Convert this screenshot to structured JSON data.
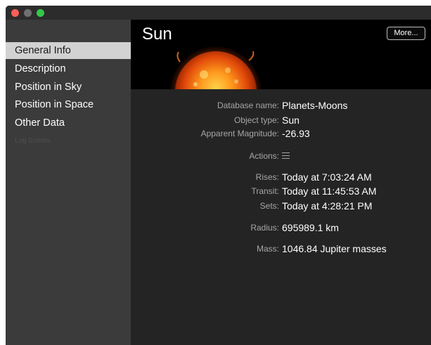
{
  "sidebar": {
    "items": [
      {
        "label": "General Info"
      },
      {
        "label": "Description"
      },
      {
        "label": "Position in Sky"
      },
      {
        "label": "Position in Space"
      },
      {
        "label": "Other Data"
      },
      {
        "label": "Log Entries"
      }
    ]
  },
  "header": {
    "title": "Sun",
    "more_label": "More..."
  },
  "info": {
    "database_name": {
      "label": "Database name:",
      "value": "Planets-Moons"
    },
    "object_type": {
      "label": "Object type:",
      "value": "Sun"
    },
    "apparent_magnitude": {
      "label": "Apparent Magnitude:",
      "value": "-26.93"
    },
    "actions": {
      "label": "Actions:",
      "icon": "menu-icon"
    },
    "rises": {
      "label": "Rises:",
      "value": "Today at 7:03:24 AM"
    },
    "transit": {
      "label": "Transit:",
      "value": "Today at 11:45:53 AM"
    },
    "sets": {
      "label": "Sets:",
      "value": "Today at 4:28:21 PM"
    },
    "radius": {
      "label": "Radius:",
      "value": "695989.1 km"
    },
    "mass": {
      "label": "Mass:",
      "value": "1046.84 Jupiter masses"
    }
  },
  "colors": {
    "close": "#fc5f57",
    "minimize": "#707070",
    "zoom": "#34c748",
    "sidebar_selected": "#d2d2d2",
    "background": "#242424"
  }
}
